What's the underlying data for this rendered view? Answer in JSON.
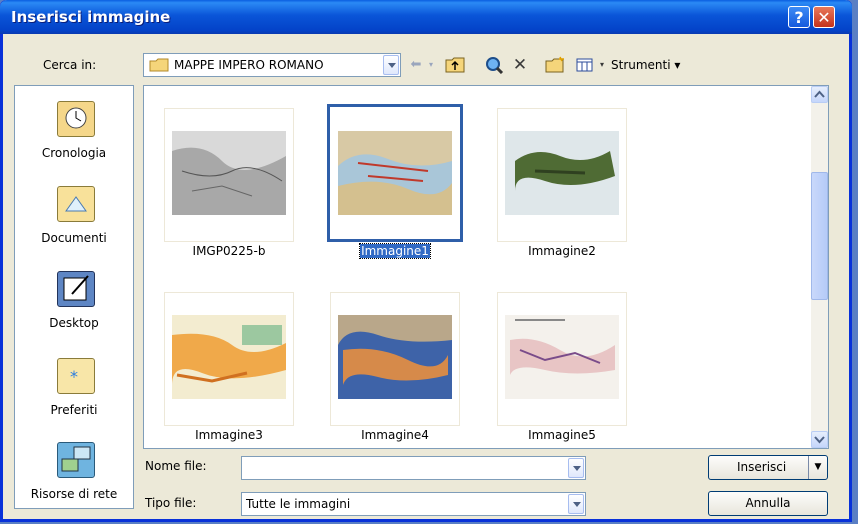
{
  "window": {
    "title": "Inserisci immagine",
    "help_glyph": "?",
    "close_glyph": "✕"
  },
  "toolbar": {
    "look_in_label": "Cerca in:",
    "look_in_value": "MAPPE IMPERO ROMANO",
    "tools_label": "Strumenti ▾"
  },
  "places": [
    {
      "label": "Cronologia",
      "icon": "history-icon"
    },
    {
      "label": "Documenti",
      "icon": "documents-folder-icon"
    },
    {
      "label": "Desktop",
      "icon": "desktop-icon"
    },
    {
      "label": "Preferiti",
      "icon": "favorites-folder-icon"
    },
    {
      "label": "Risorse di rete",
      "icon": "network-icon"
    }
  ],
  "files": [
    {
      "name": "IMGP0225-b",
      "selected": false
    },
    {
      "name": "Immagine1",
      "selected": true
    },
    {
      "name": "Immagine2",
      "selected": false
    },
    {
      "name": "Immagine3",
      "selected": false
    },
    {
      "name": "Immagine4",
      "selected": false
    },
    {
      "name": "Immagine5",
      "selected": false
    }
  ],
  "footer": {
    "filename_label": "Nome file:",
    "filename_value": "",
    "filetype_label": "Tipo file:",
    "filetype_value": "Tutte le immagini",
    "insert_label": "Inserisci",
    "cancel_label": "Annulla"
  },
  "colors": {
    "titlebar": "#0a55d8",
    "selection": "#316ac5",
    "dialog_bg": "#ece9d8"
  }
}
